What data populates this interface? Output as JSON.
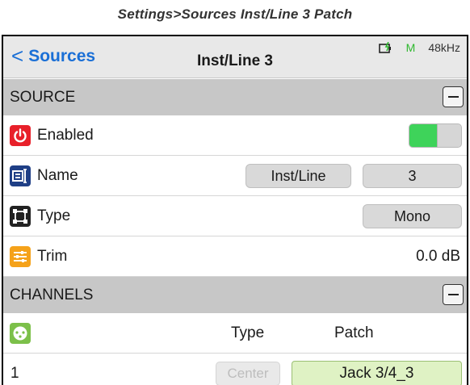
{
  "caption": "Settings>Sources Inst/Line 3 Patch",
  "navbar": {
    "back_label": "Sources",
    "title": "Inst/Line 3",
    "status_mode": "M",
    "sample_rate": "48kHz"
  },
  "source_section": {
    "header": "SOURCE",
    "enabled": {
      "label": "Enabled",
      "value": true
    },
    "name": {
      "label": "Name",
      "prefix": "Inst/Line",
      "number": "3"
    },
    "type": {
      "label": "Type",
      "value": "Mono"
    },
    "trim": {
      "label": "Trim",
      "value": "0.0 dB"
    }
  },
  "channels_section": {
    "header": "CHANNELS",
    "col_type": "Type",
    "col_patch": "Patch",
    "rows": [
      {
        "index": "1",
        "type": "Center",
        "patch": "Jack 3/4_3"
      }
    ]
  },
  "colors": {
    "accent_blue": "#1a6fd6",
    "power_red": "#e8202a",
    "name_blue": "#1f3f86",
    "trim_orange": "#f5a21a",
    "channel_green": "#7cc04a",
    "toggle_on": "#3ed35a",
    "patch_bg": "#dff2c4"
  },
  "icons": {
    "enabled": "power-icon",
    "name": "name-tag-icon",
    "type": "frame-icon",
    "trim": "sliders-icon",
    "channels": "xlr-connector-icon"
  }
}
